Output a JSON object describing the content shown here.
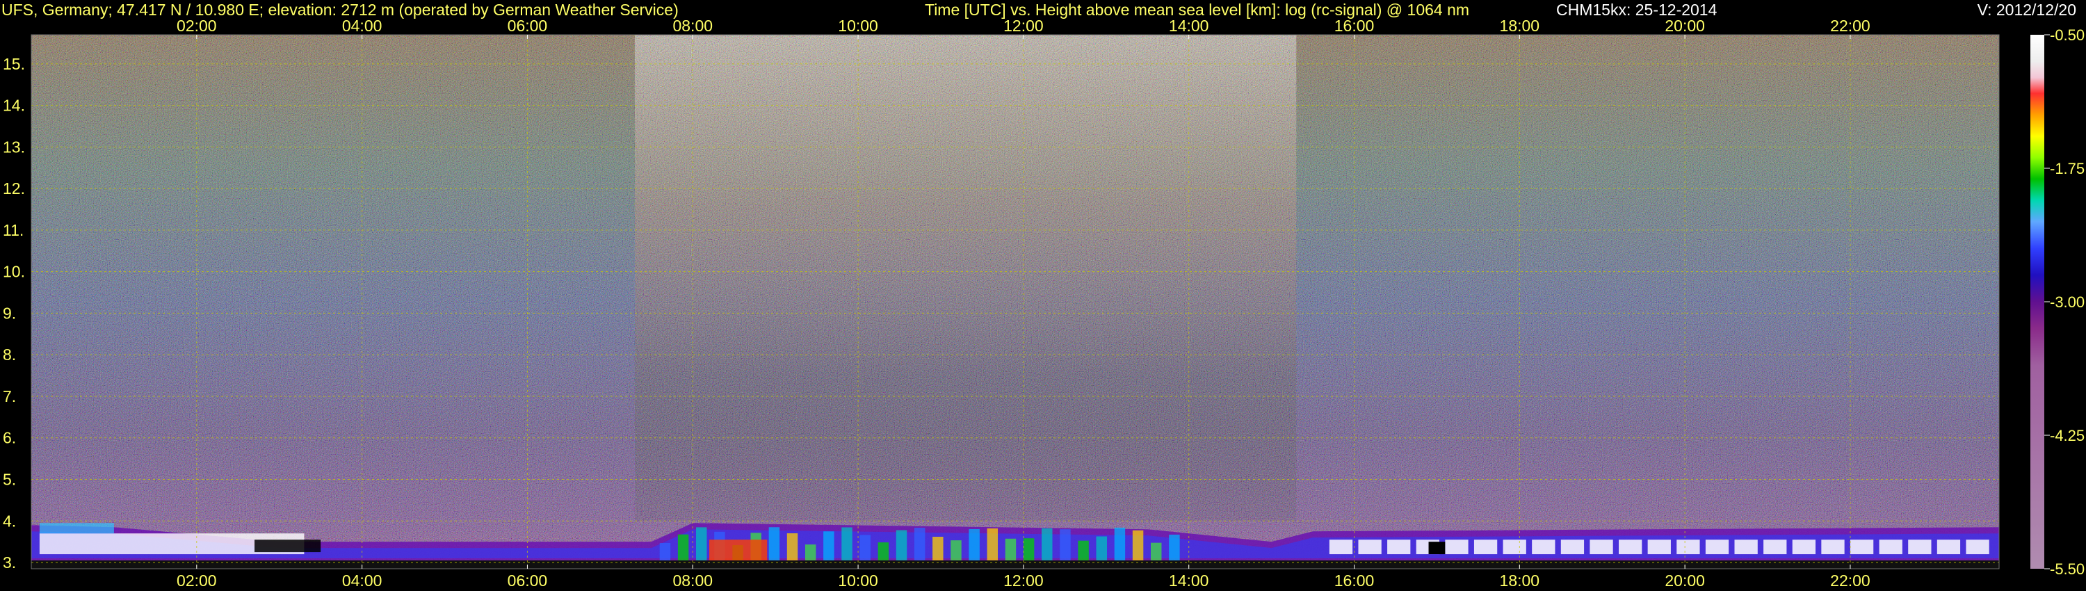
{
  "header": {
    "site": "UFS, Germany; 47.417 N / 10.980 E; elevation: 2712 m  (operated by German Weather Service)",
    "title": "Time [UTC] vs. Height above mean sea level [km]: log (rc-signal) @ 1064 nm",
    "instrument": "CHM15kx: 25-12-2014",
    "version": "V: 2012/12/20"
  },
  "colors": {
    "text_yellow": "#ffff66",
    "text_white": "#ffffff",
    "background": "#000000",
    "grid": "#c8c800"
  },
  "chart_data": {
    "type": "heatmap",
    "xunit": "hours UTC",
    "xlim": [
      0,
      23.8
    ],
    "ylim": [
      2.85,
      15.7
    ],
    "x_ticks": [
      "02:00",
      "04:00",
      "06:00",
      "08:00",
      "10:00",
      "12:00",
      "14:00",
      "16:00",
      "18:00",
      "20:00",
      "22:00"
    ],
    "x_tick_values": [
      2,
      4,
      6,
      8,
      10,
      12,
      14,
      16,
      18,
      20,
      22
    ],
    "y_ticks": [
      "3.",
      "4.",
      "5.",
      "6.",
      "7.",
      "8.",
      "9.",
      "10.",
      "11.",
      "12.",
      "13.",
      "14.",
      "15."
    ],
    "y_tick_values": [
      3,
      4,
      5,
      6,
      7,
      8,
      9,
      10,
      11,
      12,
      13,
      14,
      15
    ],
    "grid": true,
    "colorbar": {
      "ticks": [
        "-0.50",
        "-1.75",
        "-3.00",
        "-4.25",
        "-5.50"
      ],
      "tick_values": [
        -0.5,
        -1.75,
        -3.0,
        -4.25,
        -5.5
      ],
      "range": [
        -5.5,
        -0.5
      ]
    },
    "description_features": {
      "boundary_layer_top_km": [
        {
          "t": 0.0,
          "h": 3.9
        },
        {
          "t": 1.0,
          "h": 3.85
        },
        {
          "t": 3.0,
          "h": 3.5
        },
        {
          "t": 7.5,
          "h": 3.5
        },
        {
          "t": 8.0,
          "h": 3.95
        },
        {
          "t": 13.5,
          "h": 3.8
        },
        {
          "t": 15.0,
          "h": 3.5
        },
        {
          "t": 15.5,
          "h": 3.75
        },
        {
          "t": 23.8,
          "h": 3.85
        }
      ],
      "noisy_daylight_period_hours": [
        7.3,
        15.3
      ]
    }
  }
}
